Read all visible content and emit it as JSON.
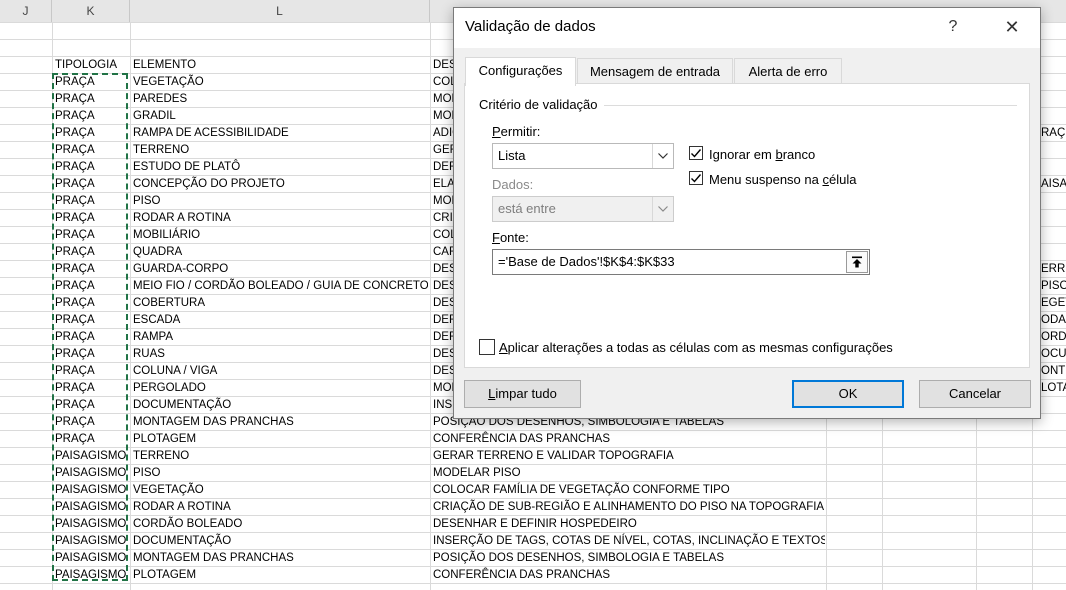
{
  "sheet": {
    "column_headers": [
      "J",
      "K",
      "L"
    ],
    "header_row": {
      "tipologia": "TIPOLOGIA",
      "elemento": "ELEMENTO",
      "descricao": "DESC"
    },
    "rows": [
      {
        "tipologia": "PRAÇA",
        "elemento": "VEGETAÇÃO",
        "descricao": "COL"
      },
      {
        "tipologia": "PRAÇA",
        "elemento": "PAREDES",
        "descricao": "MOD"
      },
      {
        "tipologia": "PRAÇA",
        "elemento": "GRADIL",
        "descricao": "MOD"
      },
      {
        "tipologia": "PRAÇA",
        "elemento": "RAMPA DE ACESSIBILIDADE",
        "descricao": "ADIC"
      },
      {
        "tipologia": "PRAÇA",
        "elemento": "TERRENO",
        "descricao": "GER"
      },
      {
        "tipologia": "PRAÇA",
        "elemento": "ESTUDO DE PLATÔ",
        "descricao": "DEF"
      },
      {
        "tipologia": "PRAÇA",
        "elemento": "CONCEPÇÃO DO PROJETO",
        "descricao": "ELAB"
      },
      {
        "tipologia": "PRAÇA",
        "elemento": "PISO",
        "descricao": "MOD"
      },
      {
        "tipologia": "PRAÇA",
        "elemento": "RODAR A ROTINA",
        "descricao": "CRIA"
      },
      {
        "tipologia": "PRAÇA",
        "elemento": "MOBILIÁRIO",
        "descricao": "COL"
      },
      {
        "tipologia": "PRAÇA",
        "elemento": "QUADRA",
        "descricao": "CAR"
      },
      {
        "tipologia": "PRAÇA",
        "elemento": "GUARDA-CORPO",
        "descricao": "DESE"
      },
      {
        "tipologia": "PRAÇA",
        "elemento": "MEIO FIO / CORDÃO BOLEADO / GUIA DE CONCRETO",
        "descricao": "DESE"
      },
      {
        "tipologia": "PRAÇA",
        "elemento": "COBERTURA",
        "descricao": "DESE"
      },
      {
        "tipologia": "PRAÇA",
        "elemento": "ESCADA",
        "descricao": "DEF"
      },
      {
        "tipologia": "PRAÇA",
        "elemento": "RAMPA",
        "descricao": "DEF"
      },
      {
        "tipologia": "PRAÇA",
        "elemento": "RUAS",
        "descricao": "DESE"
      },
      {
        "tipologia": "PRAÇA",
        "elemento": "COLUNA / VIGA",
        "descricao": "DESE"
      },
      {
        "tipologia": "PRAÇA",
        "elemento": "PERGOLADO",
        "descricao": "MOD"
      },
      {
        "tipologia": "PRAÇA",
        "elemento": "DOCUMENTAÇÃO",
        "descricao": "INSE"
      },
      {
        "tipologia": "PRAÇA",
        "elemento": "MONTAGEM DAS PRANCHAS",
        "descricao": "POSIÇÃO DOS DESENHOS, SIMBOLOGIA E TABELAS"
      },
      {
        "tipologia": "PRAÇA",
        "elemento": "PLOTAGEM",
        "descricao": "CONFERÊNCIA DAS PRANCHAS"
      },
      {
        "tipologia": "PAISAGISMO",
        "elemento": "TERRENO",
        "descricao": "GERAR TERRENO E VALIDAR TOPOGRAFIA"
      },
      {
        "tipologia": "PAISAGISMO",
        "elemento": "PISO",
        "descricao": "MODELAR PISO"
      },
      {
        "tipologia": "PAISAGISMO",
        "elemento": "VEGETAÇÃO",
        "descricao": "COLOCAR FAMÍLIA DE VEGETAÇÃO CONFORME TIPO"
      },
      {
        "tipologia": "PAISAGISMO",
        "elemento": "RODAR A ROTINA",
        "descricao": "CRIAÇÃO DE SUB-REGIÃO E ALINHAMENTO DO PISO NA TOPOGRAFIA"
      },
      {
        "tipologia": "PAISAGISMO",
        "elemento": "CORDÃO BOLEADO",
        "descricao": "DESENHAR E DEFINIR HOSPEDEIRO"
      },
      {
        "tipologia": "PAISAGISMO",
        "elemento": "DOCUMENTAÇÃO",
        "descricao": "INSERÇÃO DE TAGS, COTAS DE NÍVEL, COTAS, INCLINAÇÃO E TEXTOS"
      },
      {
        "tipologia": "PAISAGISMO",
        "elemento": "MONTAGEM DAS PRANCHAS",
        "descricao": "POSIÇÃO DOS DESENHOS, SIMBOLOGIA E TABELAS"
      },
      {
        "tipologia": "PAISAGISMO",
        "elemento": "PLOTAGEM",
        "descricao": "CONFERÊNCIA DAS PRANCHAS"
      }
    ],
    "right_edge_fragments": [
      {
        "row": 4,
        "text": "RAÇ"
      },
      {
        "row": 7,
        "text": "AISA"
      },
      {
        "row": 12,
        "text": "ERRE"
      },
      {
        "row": 13,
        "text": "PISO"
      },
      {
        "row": 14,
        "text": "EGET"
      },
      {
        "row": 15,
        "text": "ODA"
      },
      {
        "row": 16,
        "text": "ORD"
      },
      {
        "row": 17,
        "text": "OCU"
      },
      {
        "row": 18,
        "text": "ONT"
      },
      {
        "row": 19,
        "text": "LOTA"
      }
    ],
    "selection_color": "#217346"
  },
  "dialog": {
    "title": "Validação de dados",
    "help_label": "?",
    "close_label": "✕",
    "tabs": [
      {
        "label": "Configurações",
        "active": true
      },
      {
        "label": "Mensagem de entrada",
        "active": false
      },
      {
        "label": "Alerta de erro",
        "active": false
      }
    ],
    "criteria_group_label": "Critério de validação",
    "allow": {
      "label_accel": "P",
      "label_rest": "ermitir:",
      "value": "Lista"
    },
    "ignore_blank": {
      "label_pre": "Ignorar em ",
      "label_accel": "b",
      "label_post": "ranco",
      "checked": true
    },
    "in_cell_dropdown": {
      "label_pre": "Menu suspenso na ",
      "label_accel": "c",
      "label_post": "élula",
      "checked": true
    },
    "data": {
      "label": "Dados:",
      "value": "está entre",
      "disabled": true
    },
    "source": {
      "label_accel": "F",
      "label_rest": "onte:",
      "value": "='Base de Dados'!$K$4:$K$33"
    },
    "apply_all": {
      "label_pre": "",
      "label_accel": "A",
      "label_post": "plicar alterações a todas as células com as mesmas configurações",
      "checked": false
    },
    "buttons": {
      "clear_all": {
        "accel": "L",
        "rest": "impar tudo"
      },
      "ok": "OK",
      "cancel": "Cancelar"
    },
    "accent_color": "#0078d7"
  }
}
